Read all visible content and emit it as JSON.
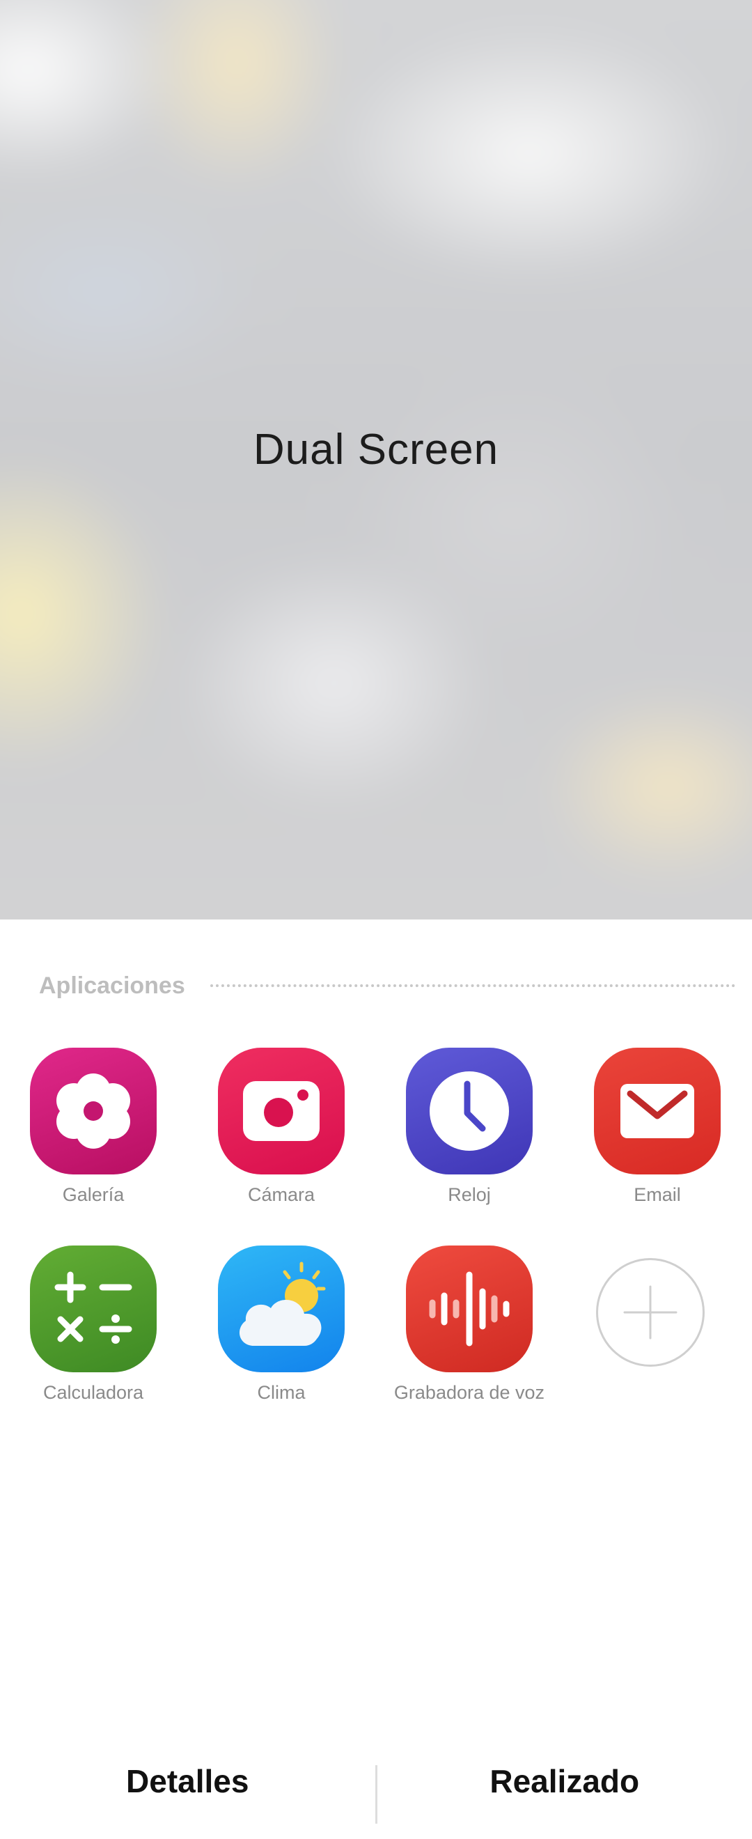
{
  "preview": {
    "title": "Dual Screen"
  },
  "apps_section": {
    "title": "Aplicaciones",
    "apps": [
      {
        "label": "Galería",
        "icon": "gallery-icon",
        "color": "#c4166f"
      },
      {
        "label": "Cámara",
        "icon": "camera-icon",
        "color": "#e2195a"
      },
      {
        "label": "Reloj",
        "icon": "clock-icon",
        "color": "#4a46c8"
      },
      {
        "label": "Email",
        "icon": "email-icon",
        "color": "#e2352e"
      },
      {
        "label": "Calculadora",
        "icon": "calculator-icon",
        "color": "#4f9a2a"
      },
      {
        "label": "Clima",
        "icon": "weather-icon",
        "color": "#1a9cf0"
      },
      {
        "label": "Grabadora de voz",
        "icon": "voice-recorder-icon",
        "color": "#e23a2e"
      }
    ],
    "add_icon": "add-icon"
  },
  "bottom_bar": {
    "details_label": "Detalles",
    "done_label": "Realizado"
  }
}
